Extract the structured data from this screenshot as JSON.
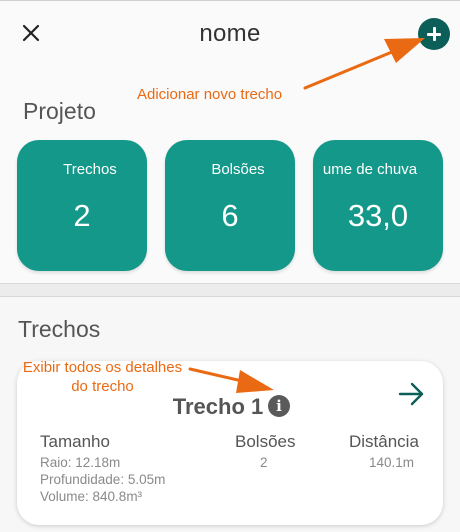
{
  "header": {
    "title": "nome"
  },
  "annotations": {
    "add_trecho": "Adicionar novo trecho",
    "details_line1": "Exibir todos os detalhes",
    "details_line2": "do trecho"
  },
  "projeto": {
    "heading": "Projeto",
    "stats": [
      {
        "label": "Trechos",
        "value": "2"
      },
      {
        "label": "Bolsões",
        "value": "6"
      },
      {
        "label": "ume de chuva",
        "value": "33,0"
      }
    ]
  },
  "trechos": {
    "heading": "Trechos",
    "items": [
      {
        "title": "Trecho 1",
        "tamanho": {
          "label": "Tamanho",
          "raio": "Raio: 12.18m",
          "profundidade": "Profundidade: 5.05m",
          "volume": "Volume: 840.8m³"
        },
        "bolsoes": {
          "label": "Bolsões",
          "value": "2"
        },
        "distancia": {
          "label": "Distância",
          "value": "140.1m"
        }
      }
    ]
  },
  "icons": {
    "close": "close-icon",
    "add": "plus-icon",
    "info": "info-icon",
    "open": "arrow-right-icon"
  },
  "colors": {
    "accent": "#0c5e58",
    "card": "#13988a",
    "annotation": "#ea6a14"
  }
}
